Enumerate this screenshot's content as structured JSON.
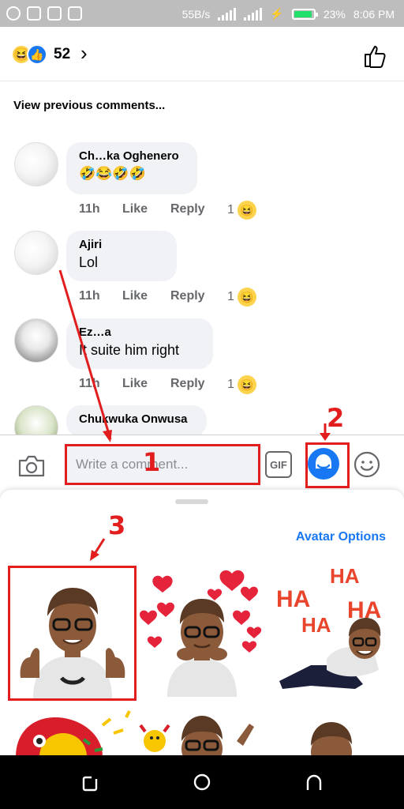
{
  "status_bar": {
    "speed": "55B/s",
    "battery": "23%",
    "time": "8:06 PM"
  },
  "reactions": {
    "count": "52"
  },
  "view_previous_label": "View previous comments...",
  "comments": [
    {
      "name": "Ch…ka Oghenero",
      "text": "🤣😂🤣🤣",
      "time": "11h",
      "like": "Like",
      "reply": "Reply",
      "reactions": "1"
    },
    {
      "name": "Ajiri",
      "text": "Lol",
      "time": "11h",
      "like": "Like",
      "reply": "Reply",
      "reactions": "1"
    },
    {
      "name": "Ez…a",
      "text": "It suite him right",
      "time": "11h",
      "like": "Like",
      "reply": "Reply",
      "reactions": "1"
    },
    {
      "name": "Chukwuka Onwusa",
      "text": "",
      "time": "",
      "like": "",
      "reply": "",
      "reactions": ""
    }
  ],
  "composer": {
    "placeholder": "Write a comment...",
    "gif_label": "GIF"
  },
  "sheet": {
    "avatar_options_label": "Avatar Options",
    "sticker_texts": [
      "HA",
      "HA",
      "HA",
      "HA"
    ]
  },
  "annotations": [
    "1",
    "2",
    "3"
  ],
  "colors": {
    "accent": "#1877f2",
    "annotation": "#e11d1d",
    "bubble": "#f0f2f5"
  }
}
